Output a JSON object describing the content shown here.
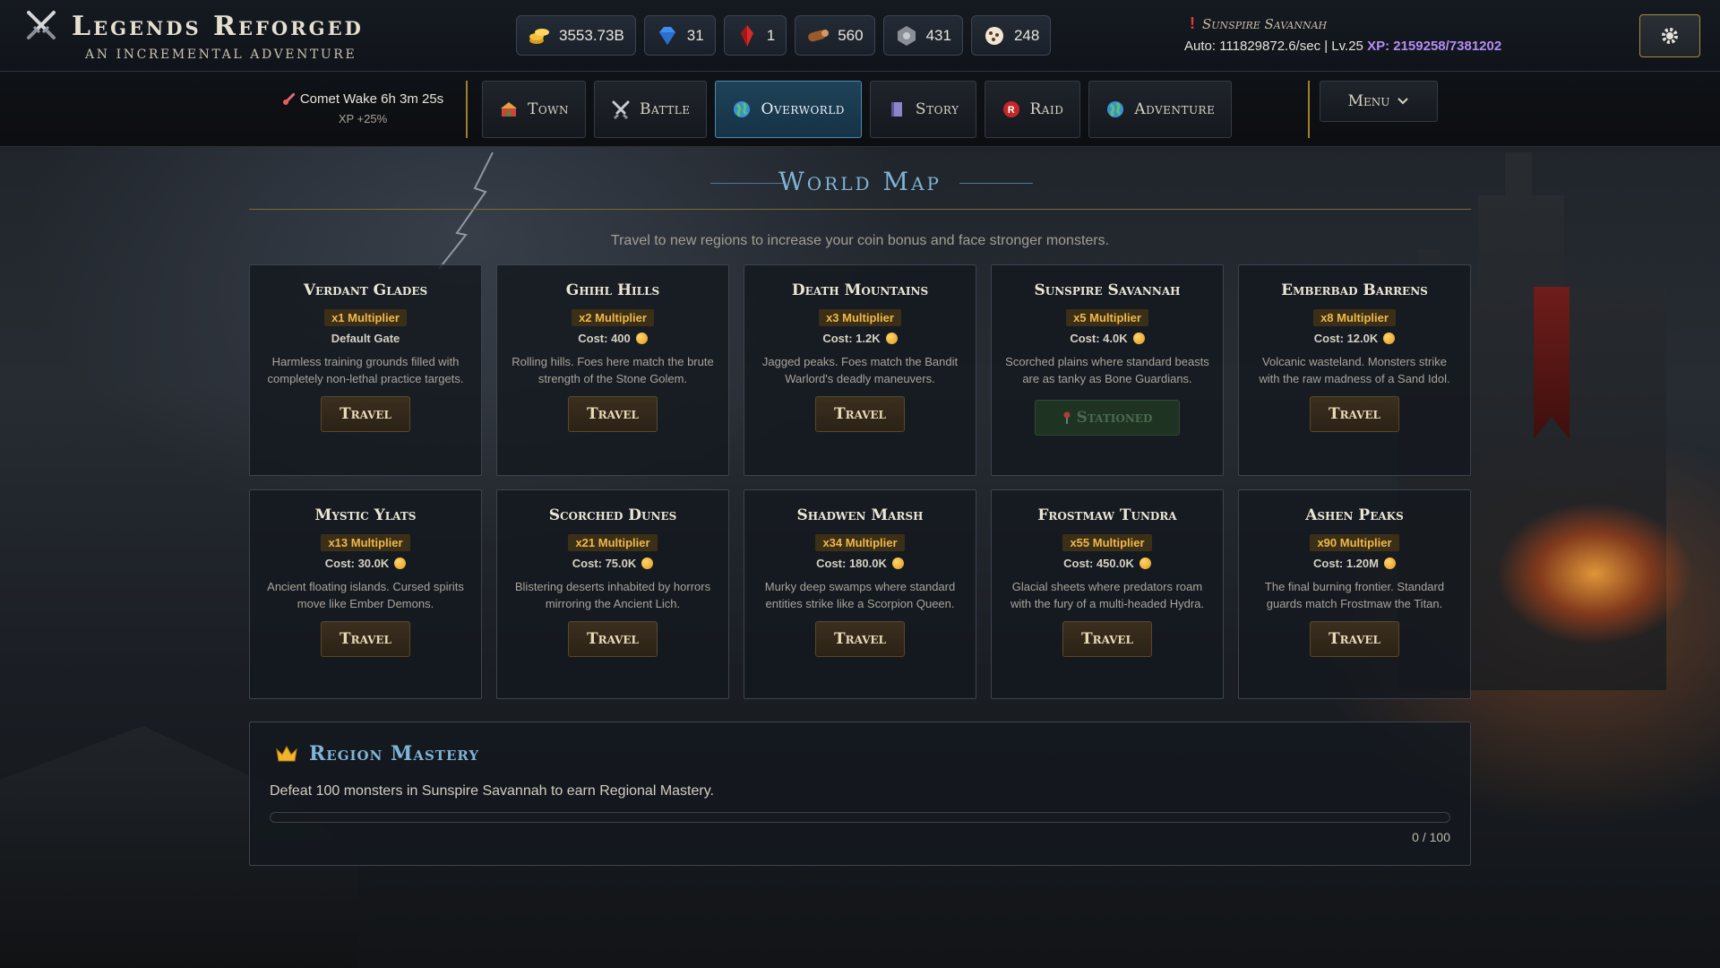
{
  "brand": {
    "title": "Legends Reforged",
    "subtitle": "AN INCREMENTAL ADVENTURE",
    "icon": "crossed-swords-icon"
  },
  "resources": [
    {
      "name": "gold-coins",
      "icon": "coins-icon",
      "value": "3553.73B"
    },
    {
      "name": "diamonds",
      "icon": "diamond-icon",
      "value": "31"
    },
    {
      "name": "red-crystals",
      "icon": "red-crystal-icon",
      "value": "1"
    },
    {
      "name": "wood",
      "icon": "log-icon",
      "value": "560"
    },
    {
      "name": "ore",
      "icon": "ore-icon",
      "value": "431"
    },
    {
      "name": "cookies",
      "icon": "cookie-icon",
      "value": "248"
    }
  ],
  "status": {
    "alert": "!",
    "region": "Sunspire Savannah",
    "auto_text": "Auto: 111829872.6/sec | Lv.25",
    "xp_text": "XP: 2159258/7381202"
  },
  "event": {
    "name": "Comet Wake 6h 3m 25s",
    "bonus": "XP +25%"
  },
  "tabs": [
    {
      "label": "Town",
      "icon": "town-icon",
      "active": false
    },
    {
      "label": "Battle",
      "icon": "swords-icon",
      "active": false
    },
    {
      "label": "Overworld",
      "icon": "globe-icon",
      "active": true
    },
    {
      "label": "Story",
      "icon": "book-icon",
      "active": false
    },
    {
      "label": "Raid",
      "icon": "raid-icon",
      "active": false
    },
    {
      "label": "Adventure",
      "icon": "globe-icon",
      "active": false
    }
  ],
  "menu": {
    "label": "Menu"
  },
  "world_map": {
    "title": "World Map",
    "description": "Travel to new regions to increase your coin bonus and face stronger monsters.",
    "regions": [
      {
        "name": "Verdant Glades",
        "multiplier": "x1 Multiplier",
        "cost": "Default Gate",
        "has_coin": false,
        "description": "Harmless training grounds filled with completely non-lethal practice targets.",
        "button": "Travel",
        "stationed": false
      },
      {
        "name": "Ghihl Hills",
        "multiplier": "x2 Multiplier",
        "cost": "Cost: 400",
        "has_coin": true,
        "description": "Rolling hills. Foes here match the brute strength of the Stone Golem.",
        "button": "Travel",
        "stationed": false
      },
      {
        "name": "Death Mountains",
        "multiplier": "x3 Multiplier",
        "cost": "Cost: 1.2K",
        "has_coin": true,
        "description": "Jagged peaks. Foes match the Bandit Warlord's deadly maneuvers.",
        "button": "Travel",
        "stationed": false
      },
      {
        "name": "Sunspire Savannah",
        "multiplier": "x5 Multiplier",
        "cost": "Cost: 4.0K",
        "has_coin": true,
        "description": "Scorched plains where standard beasts are as tanky as Bone Guardians.",
        "button": "Stationed",
        "stationed": true
      },
      {
        "name": "Emberbad Barrens",
        "multiplier": "x8 Multiplier",
        "cost": "Cost: 12.0K",
        "has_coin": true,
        "description": "Volcanic wasteland. Monsters strike with the raw madness of a Sand Idol.",
        "button": "Travel",
        "stationed": false
      },
      {
        "name": "Mystic Ylats",
        "multiplier": "x13 Multiplier",
        "cost": "Cost: 30.0K",
        "has_coin": true,
        "description": "Ancient floating islands. Cursed spirits move like Ember Demons.",
        "button": "Travel",
        "stationed": false
      },
      {
        "name": "Scorched Dunes",
        "multiplier": "x21 Multiplier",
        "cost": "Cost: 75.0K",
        "has_coin": true,
        "description": "Blistering deserts inhabited by horrors mirroring the Ancient Lich.",
        "button": "Travel",
        "stationed": false
      },
      {
        "name": "Shadwen Marsh",
        "multiplier": "x34 Multiplier",
        "cost": "Cost: 180.0K",
        "has_coin": true,
        "description": "Murky deep swamps where standard entities strike like a Scorpion Queen.",
        "button": "Travel",
        "stationed": false
      },
      {
        "name": "Frostmaw Tundra",
        "multiplier": "x55 Multiplier",
        "cost": "Cost: 450.0K",
        "has_coin": true,
        "description": "Glacial sheets where predators roam with the fury of a multi-headed Hydra.",
        "button": "Travel",
        "stationed": false
      },
      {
        "name": "Ashen Peaks",
        "multiplier": "x90 Multiplier",
        "cost": "Cost: 1.20M",
        "has_coin": true,
        "description": "The final burning frontier. Standard guards match Frostmaw the Titan.",
        "button": "Travel",
        "stationed": false
      }
    ]
  },
  "mastery": {
    "title": "Region Mastery",
    "description": "Defeat 100 monsters in Sunspire Savannah to earn Regional Mastery.",
    "progress_text": "0 / 100",
    "progress_fraction": 0
  },
  "colors": {
    "accent_blue": "#7fb4d6",
    "gold": "#f0b84a",
    "xp_purple": "#b68cf5",
    "active_tab": "#1f4258"
  }
}
